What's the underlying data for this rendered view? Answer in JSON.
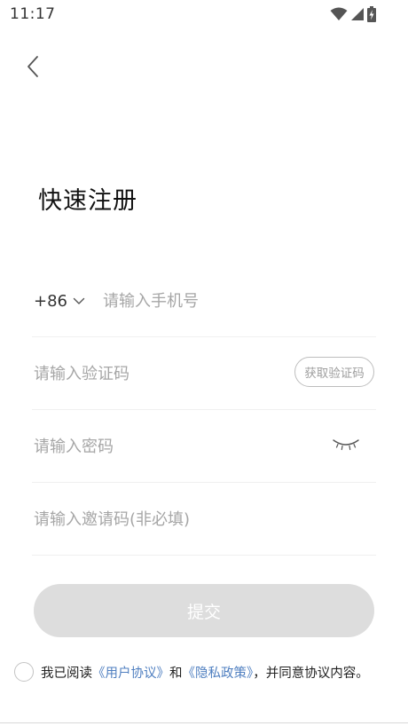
{
  "status_bar": {
    "time": "11:17",
    "icons": [
      "wifi-icon",
      "cellular-signal-icon",
      "battery-charging-icon"
    ]
  },
  "header": {
    "back_icon": "chevron-left-icon",
    "title": "快速注册"
  },
  "form": {
    "phone": {
      "country_code": "+86",
      "placeholder": "请输入手机号",
      "value": ""
    },
    "verification": {
      "placeholder": "请输入验证码",
      "value": "",
      "button_label": "获取验证码"
    },
    "password": {
      "placeholder": "请输入密码",
      "value": "",
      "toggle_icon": "eye-closed-icon"
    },
    "invite": {
      "placeholder": "请输入邀请码(非必填)",
      "value": ""
    }
  },
  "submit": {
    "label": "提交"
  },
  "agreement": {
    "prefix": "我已阅读",
    "user_agreement": "《用户协议》",
    "conjunction": "和",
    "privacy_policy": "《隐私政策》",
    "suffix": "，并同意协议内容。",
    "checked": false
  },
  "colors": {
    "link": "#4f7fc0",
    "submit_disabled_bg": "#dddddd",
    "placeholder": "#a6a6a6",
    "divider": "#f0f0f0"
  }
}
